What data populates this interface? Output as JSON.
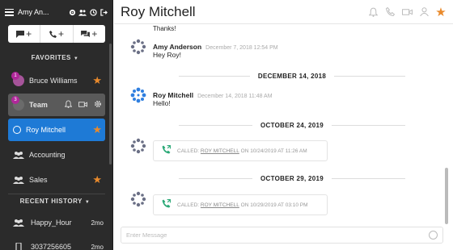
{
  "sidebar": {
    "user_name": "Amy An...",
    "favorites_title": "FAVORITES",
    "recent_title": "RECENT HISTORY",
    "favorites": [
      {
        "label": "Bruce Williams",
        "badge": "1"
      },
      {
        "label": "Team",
        "badge": "3"
      },
      {
        "label": "Roy Mitchell"
      },
      {
        "label": "Accounting"
      },
      {
        "label": "Sales"
      }
    ],
    "recent": [
      {
        "label": "Happy_Hour",
        "time": "2mo"
      },
      {
        "label": "3037256605",
        "time": "2mo"
      }
    ]
  },
  "conversation": {
    "title": "Roy Mitchell",
    "partial_text": "Thanks!",
    "messages": [
      {
        "sender": "Amy Anderson",
        "time": "December 7, 2018 12:54 PM",
        "text": "Hey Roy!"
      },
      {
        "sender": "Roy Mitchell",
        "time": "December 14, 2018 11:48 AM",
        "text": "Hello!"
      }
    ],
    "date_separators": [
      "DECEMBER 14, 2018",
      "OCTOBER 24, 2019",
      "OCTOBER 29, 2019"
    ],
    "calls": [
      {
        "prefix": "CALLED:",
        "name": "ROY MITCHELL",
        "suffix": "ON 10/24/2019 AT 11:26 AM"
      },
      {
        "prefix": "CALLED:",
        "name": "ROY MITCHELL",
        "suffix": "ON 10/29/2019 AT 03:10 PM"
      }
    ]
  },
  "composer": {
    "placeholder": "Enter Message"
  },
  "colors": {
    "sidebar_bg": "#2b2b2b",
    "active_blue": "#1e7ad6",
    "star_orange": "#e98a2c",
    "badge_purple": "#b0279a",
    "call_green": "#2aa876"
  }
}
